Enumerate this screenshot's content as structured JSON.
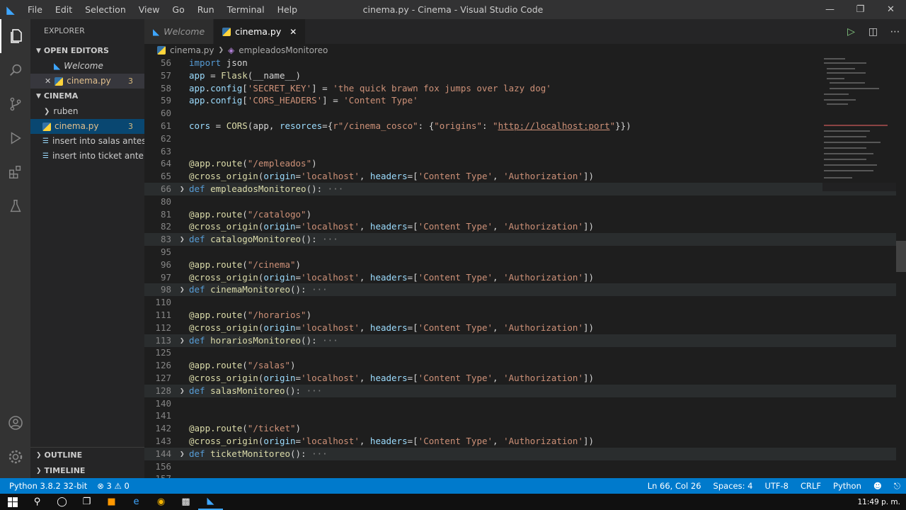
{
  "titlebar": {
    "menu": [
      "File",
      "Edit",
      "Selection",
      "View",
      "Go",
      "Run",
      "Terminal",
      "Help"
    ],
    "title": "cinema.py - Cinema - Visual Studio Code"
  },
  "activitybar": {
    "icons": [
      "files-icon",
      "search-icon",
      "source-control-icon",
      "run-debug-icon",
      "extensions-icon",
      "testing-icon"
    ]
  },
  "sidebar": {
    "header": "EXPLORER",
    "open_editors_label": "OPEN EDITORS",
    "open_editors": [
      {
        "label": "Welcome",
        "type": "welcome"
      },
      {
        "label": "cinema.py",
        "badge": "3",
        "type": "python"
      }
    ],
    "workspace_label": "CINEMA",
    "files": [
      {
        "label": "ruben",
        "type": "folder"
      },
      {
        "label": "cinema.py",
        "badge": "3",
        "type": "python"
      },
      {
        "label": "insert into salas antes...",
        "type": "text"
      },
      {
        "label": "insert into ticket ante...",
        "type": "text"
      }
    ],
    "outline_label": "OUTLINE",
    "timeline_label": "TIMELINE"
  },
  "tabs": [
    {
      "label": "Welcome",
      "active": false
    },
    {
      "label": "cinema.py",
      "active": true
    }
  ],
  "breadcrumb": {
    "file": "cinema.py",
    "symbol": "empleadosMonitoreo"
  },
  "editor": {
    "lines": [
      {
        "n": "56",
        "tokens": [
          [
            "k",
            "import "
          ],
          [
            "n",
            "json"
          ]
        ]
      },
      {
        "n": "57",
        "tokens": [
          [
            "v",
            "app"
          ],
          [
            "n",
            " = "
          ],
          [
            "d",
            "Flask"
          ],
          [
            "n",
            "(__name__)"
          ]
        ]
      },
      {
        "n": "58",
        "tokens": [
          [
            "v",
            "app"
          ],
          [
            "n",
            "."
          ],
          [
            "v",
            "config"
          ],
          [
            "n",
            "["
          ],
          [
            "s",
            "'SECRET_KEY'"
          ],
          [
            "n",
            "] = "
          ],
          [
            "s",
            "'the quick brawn fox jumps over lazy dog'"
          ]
        ]
      },
      {
        "n": "59",
        "tokens": [
          [
            "v",
            "app"
          ],
          [
            "n",
            "."
          ],
          [
            "v",
            "config"
          ],
          [
            "n",
            "["
          ],
          [
            "s",
            "'CORS_HEADERS'"
          ],
          [
            "n",
            "] = "
          ],
          [
            "s",
            "'Content Type'"
          ]
        ]
      },
      {
        "n": "60",
        "tokens": []
      },
      {
        "n": "61",
        "tokens": [
          [
            "v",
            "cors"
          ],
          [
            "n",
            " = "
          ],
          [
            "d",
            "CORS"
          ],
          [
            "n",
            "(app, "
          ],
          [
            "v",
            "resorces"
          ],
          [
            "n",
            "={"
          ],
          [
            "s",
            "r\"/cinema_cosco\""
          ],
          [
            "n",
            ": {"
          ],
          [
            "s",
            "\"origins\""
          ],
          [
            "n",
            ": "
          ],
          [
            "s",
            "\""
          ],
          [
            "u",
            "http://localhost:port"
          ],
          [
            "s",
            "\""
          ],
          [
            "n",
            "}})"
          ]
        ]
      },
      {
        "n": "62",
        "tokens": []
      },
      {
        "n": "63",
        "tokens": []
      },
      {
        "n": "64",
        "tokens": [
          [
            "d",
            "@app.route"
          ],
          [
            "n",
            "("
          ],
          [
            "s",
            "\"/empleados\""
          ],
          [
            "n",
            ")"
          ]
        ]
      },
      {
        "n": "65",
        "tokens": [
          [
            "d",
            "@cross_origin"
          ],
          [
            "n",
            "("
          ],
          [
            "v",
            "origin"
          ],
          [
            "n",
            "="
          ],
          [
            "s",
            "'localhost'"
          ],
          [
            "n",
            ", "
          ],
          [
            "v",
            "headers"
          ],
          [
            "n",
            "=["
          ],
          [
            "s",
            "'Content Type'"
          ],
          [
            "n",
            ", "
          ],
          [
            "s",
            "'Authorization'"
          ],
          [
            "n",
            "])"
          ]
        ]
      },
      {
        "n": "66",
        "folded": true,
        "tokens": [
          [
            "k",
            "def "
          ],
          [
            "f",
            "empleadosMonitoreo"
          ],
          [
            "n",
            "():"
          ]
        ]
      },
      {
        "n": "80",
        "tokens": []
      },
      {
        "n": "81",
        "tokens": [
          [
            "d",
            "@app.route"
          ],
          [
            "n",
            "("
          ],
          [
            "s",
            "\"/catalogo\""
          ],
          [
            "n",
            ")"
          ]
        ]
      },
      {
        "n": "82",
        "tokens": [
          [
            "d",
            "@cross_origin"
          ],
          [
            "n",
            "("
          ],
          [
            "v",
            "origin"
          ],
          [
            "n",
            "="
          ],
          [
            "s",
            "'localhost'"
          ],
          [
            "n",
            ", "
          ],
          [
            "v",
            "headers"
          ],
          [
            "n",
            "=["
          ],
          [
            "s",
            "'Content Type'"
          ],
          [
            "n",
            ", "
          ],
          [
            "s",
            "'Authorization'"
          ],
          [
            "n",
            "])"
          ]
        ]
      },
      {
        "n": "83",
        "folded": true,
        "tokens": [
          [
            "k",
            "def "
          ],
          [
            "f",
            "catalogoMonitoreo"
          ],
          [
            "n",
            "():"
          ]
        ]
      },
      {
        "n": "95",
        "tokens": []
      },
      {
        "n": "96",
        "tokens": [
          [
            "d",
            "@app.route"
          ],
          [
            "n",
            "("
          ],
          [
            "s",
            "\"/cinema\""
          ],
          [
            "n",
            ")"
          ]
        ]
      },
      {
        "n": "97",
        "tokens": [
          [
            "d",
            "@cross_origin"
          ],
          [
            "n",
            "("
          ],
          [
            "v",
            "origin"
          ],
          [
            "n",
            "="
          ],
          [
            "s",
            "'localhost'"
          ],
          [
            "n",
            ", "
          ],
          [
            "v",
            "headers"
          ],
          [
            "n",
            "=["
          ],
          [
            "s",
            "'Content Type'"
          ],
          [
            "n",
            ", "
          ],
          [
            "s",
            "'Authorization'"
          ],
          [
            "n",
            "])"
          ]
        ]
      },
      {
        "n": "98",
        "folded": true,
        "tokens": [
          [
            "k",
            "def "
          ],
          [
            "f",
            "cinemaMonitoreo"
          ],
          [
            "n",
            "():"
          ]
        ]
      },
      {
        "n": "110",
        "tokens": []
      },
      {
        "n": "111",
        "tokens": [
          [
            "d",
            "@app.route"
          ],
          [
            "n",
            "("
          ],
          [
            "s",
            "\"/horarios\""
          ],
          [
            "n",
            ")"
          ]
        ]
      },
      {
        "n": "112",
        "tokens": [
          [
            "d",
            "@cross_origin"
          ],
          [
            "n",
            "("
          ],
          [
            "v",
            "origin"
          ],
          [
            "n",
            "="
          ],
          [
            "s",
            "'localhost'"
          ],
          [
            "n",
            ", "
          ],
          [
            "v",
            "headers"
          ],
          [
            "n",
            "=["
          ],
          [
            "s",
            "'Content Type'"
          ],
          [
            "n",
            ", "
          ],
          [
            "s",
            "'Authorization'"
          ],
          [
            "n",
            "])"
          ]
        ]
      },
      {
        "n": "113",
        "folded": true,
        "tokens": [
          [
            "k",
            "def "
          ],
          [
            "f",
            "horariosMonitoreo"
          ],
          [
            "n",
            "():"
          ]
        ]
      },
      {
        "n": "125",
        "tokens": []
      },
      {
        "n": "126",
        "tokens": [
          [
            "d",
            "@app.route"
          ],
          [
            "n",
            "("
          ],
          [
            "s",
            "\"/salas\""
          ],
          [
            "n",
            ")"
          ]
        ]
      },
      {
        "n": "127",
        "tokens": [
          [
            "d",
            "@cross_origin"
          ],
          [
            "n",
            "("
          ],
          [
            "v",
            "origin"
          ],
          [
            "n",
            "="
          ],
          [
            "s",
            "'localhost'"
          ],
          [
            "n",
            ", "
          ],
          [
            "v",
            "headers"
          ],
          [
            "n",
            "=["
          ],
          [
            "s",
            "'Content Type'"
          ],
          [
            "n",
            ", "
          ],
          [
            "s",
            "'Authorization'"
          ],
          [
            "n",
            "])"
          ]
        ]
      },
      {
        "n": "128",
        "folded": true,
        "tokens": [
          [
            "k",
            "def "
          ],
          [
            "f",
            "salasMonitoreo"
          ],
          [
            "n",
            "():"
          ]
        ]
      },
      {
        "n": "140",
        "tokens": []
      },
      {
        "n": "141",
        "tokens": []
      },
      {
        "n": "142",
        "tokens": [
          [
            "d",
            "@app.route"
          ],
          [
            "n",
            "("
          ],
          [
            "s",
            "\"/ticket\""
          ],
          [
            "n",
            ")"
          ]
        ]
      },
      {
        "n": "143",
        "tokens": [
          [
            "d",
            "@cross_origin"
          ],
          [
            "n",
            "("
          ],
          [
            "v",
            "origin"
          ],
          [
            "n",
            "="
          ],
          [
            "s",
            "'localhost'"
          ],
          [
            "n",
            ", "
          ],
          [
            "v",
            "headers"
          ],
          [
            "n",
            "=["
          ],
          [
            "s",
            "'Content Type'"
          ],
          [
            "n",
            ", "
          ],
          [
            "s",
            "'Authorization'"
          ],
          [
            "n",
            "])"
          ]
        ]
      },
      {
        "n": "144",
        "folded": true,
        "tokens": [
          [
            "k",
            "def "
          ],
          [
            "f",
            "ticketMonitoreo"
          ],
          [
            "n",
            "():"
          ]
        ]
      },
      {
        "n": "156",
        "tokens": []
      },
      {
        "n": "157",
        "tokens": []
      }
    ]
  },
  "statusbar": {
    "interpreter": "Python 3.8.2 32-bit",
    "errors": "3",
    "warnings": "0",
    "position": "Ln 66, Col 26",
    "spaces": "Spaces: 4",
    "encoding": "UTF-8",
    "eol": "CRLF",
    "language": "Python"
  },
  "taskbar": {
    "clock": "11:49 p. m."
  },
  "colors": {
    "accent": "#007acc",
    "editor_bg": "#1e1e1e",
    "sidebar_bg": "#252526"
  }
}
